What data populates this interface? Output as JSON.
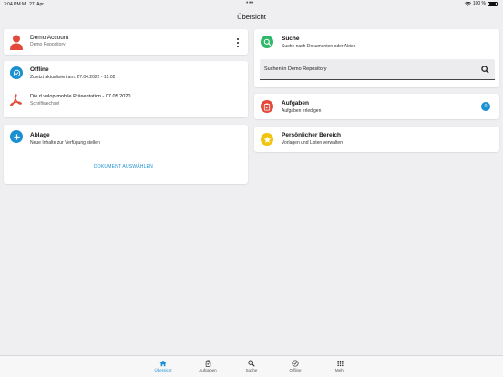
{
  "status_bar": {
    "time_date": "3:04 PM  Mi. 27. Apr.",
    "battery": "100 %"
  },
  "nav": {
    "title": "Übersicht"
  },
  "account": {
    "name": "Demo Account",
    "repository": "Demo Repository"
  },
  "offline": {
    "title": "Offline",
    "last_updated": "Zuletzt aktualisiert am: 27.04.2022 - 15:02",
    "document_title": "Die d.velop-mobile Präsentation - 07.05.2020",
    "document_category": "Schriftwechsel"
  },
  "ablage": {
    "title": "Ablage",
    "subtitle": "Neue Inhalte zur Verfügung stellen",
    "action_label": "DOKUMENT AUSWÄHLEN"
  },
  "suche": {
    "title": "Suche",
    "subtitle": "Suche nach Dokumenten oder Akten",
    "placeholder": "Suchen in Demo Repository"
  },
  "aufgaben": {
    "title": "Aufgaben",
    "subtitle": "Aufgaben erledigen",
    "count": "0"
  },
  "personal": {
    "title": "Persönlicher Bereich",
    "subtitle": "Vorlagen und Listen verwalten"
  },
  "tabbar": {
    "items": [
      {
        "label": "Übersicht",
        "icon": "home-icon",
        "active": true
      },
      {
        "label": "Aufgaben",
        "icon": "clipboard-icon",
        "active": false
      },
      {
        "label": "Suche",
        "icon": "search-icon",
        "active": false
      },
      {
        "label": "Offline",
        "icon": "offline-icon",
        "active": false
      },
      {
        "label": "Mehr",
        "icon": "grid-icon",
        "active": false
      }
    ]
  },
  "colors": {
    "accent": "#1a8fd1",
    "red": "#e34a3c",
    "green": "#2fb86a",
    "yellow": "#f1c40f",
    "background": "#efeff1"
  }
}
